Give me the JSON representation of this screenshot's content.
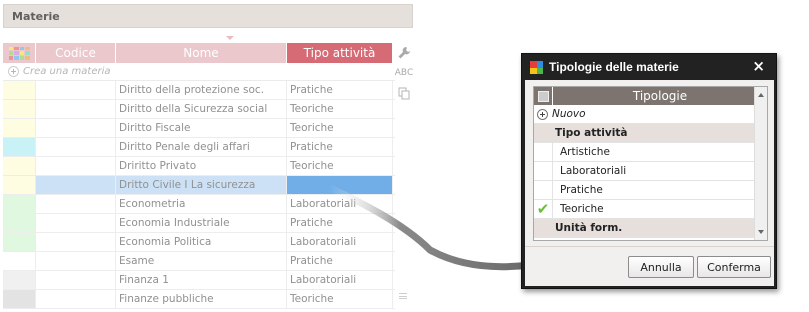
{
  "panel": {
    "title": "Materie"
  },
  "grid": {
    "columns": {
      "code": "Codice",
      "name": "Nome",
      "type": "Tipo attività"
    },
    "create_placeholder": "Crea una materia",
    "rows": [
      {
        "color": "#fffdd6",
        "code": "",
        "name": "Diritto della protezione soc.",
        "type": "Pratiche"
      },
      {
        "color": "#fffdd6",
        "code": "",
        "name": "Diritto della Sicurezza social",
        "type": "Teoriche"
      },
      {
        "color": "#fffdd6",
        "code": "",
        "name": "Diritto Fiscale",
        "type": "Teoriche"
      },
      {
        "color": "#b4eef4",
        "code": "",
        "name": "Diritto Penale degli affari",
        "type": "Pratiche"
      },
      {
        "color": "#fffdd6",
        "code": "",
        "name": "Driritto Privato",
        "type": "Teoriche"
      },
      {
        "color": "#fffdd6",
        "code": "",
        "name": "Dritto Civile I La sicurezza",
        "type": "",
        "selected": true
      },
      {
        "color": "#d6f5d4",
        "code": "",
        "name": "Econometria",
        "type": "Laboratoriali"
      },
      {
        "color": "#d6f5d4",
        "code": "",
        "name": "Economia Industriale",
        "type": "Pratiche"
      },
      {
        "color": "#d6f5d4",
        "code": "",
        "name": "Economia Politica",
        "type": "Laboratoriali"
      },
      {
        "color": "#ffffff",
        "code": "",
        "name": "Esame",
        "type": "Pratiche"
      },
      {
        "color": "#ebebeb",
        "code": "",
        "name": "Finanza 1",
        "type": "Laboratoriali"
      },
      {
        "color": "#d9d9d9",
        "code": "",
        "name": "Finanze pubbliche",
        "type": "Teoriche"
      }
    ]
  },
  "tools": {
    "spell": "ABC"
  },
  "dialog": {
    "title": "Tipologie delle materie",
    "close": "×",
    "list_header": "Tipologie",
    "new_label": "Nuovo",
    "groups": [
      {
        "label": "Tipo attività",
        "items": [
          {
            "label": "Artistiche",
            "checked": false
          },
          {
            "label": "Laboratoriali",
            "checked": false
          },
          {
            "label": "Pratiche",
            "checked": false
          },
          {
            "label": "Teoriche",
            "checked": true
          }
        ]
      },
      {
        "label": "Unità form.",
        "items": []
      }
    ],
    "cancel_label": "Annulla",
    "confirm_label": "Conferma"
  },
  "icons": {
    "palette": "color-palette-icon",
    "wrench": "wrench-icon",
    "spell": "spellcheck-icon",
    "copy": "copy-icon",
    "logo": "app-logo-icon",
    "check": "checkmark-icon"
  }
}
